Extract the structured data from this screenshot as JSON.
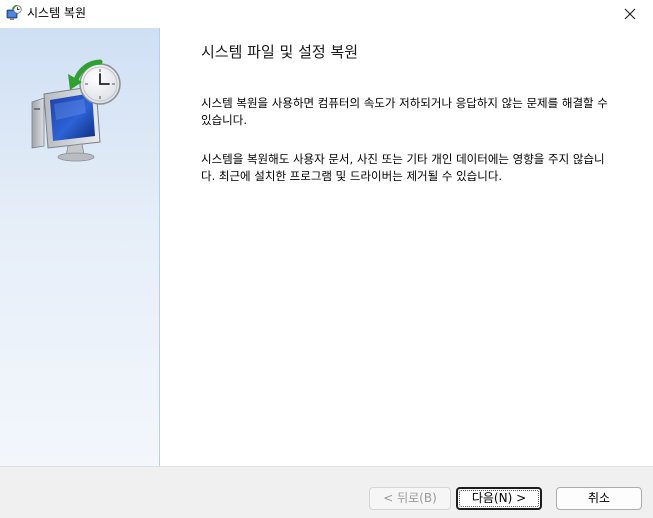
{
  "window": {
    "title": "시스템 복원",
    "icon": "system-restore-icon",
    "close_icon": "close-icon"
  },
  "banner": {
    "icon": "system-restore-computer-icon",
    "colors": {
      "gradient_top": "#cfe0f4",
      "gradient_bottom": "#f3f7fc"
    }
  },
  "content": {
    "heading": "시스템 파일 및 설정 복원",
    "paragraph1": "시스템 복원을 사용하면 컴퓨터의 속도가 저하되거나 응답하지 않는 문제를 해결할 수 있습니다.",
    "paragraph2": "시스템을 복원해도 사용자 문서, 사진 또는 기타 개인 데이터에는 영향을 주지 않습니다. 최근에 설치한 프로그램 및 드라이버는 제거될 수 있습니다."
  },
  "footer": {
    "back_label": "< 뒤로(B)",
    "next_label": "다음(N) >",
    "cancel_label": "취소"
  }
}
